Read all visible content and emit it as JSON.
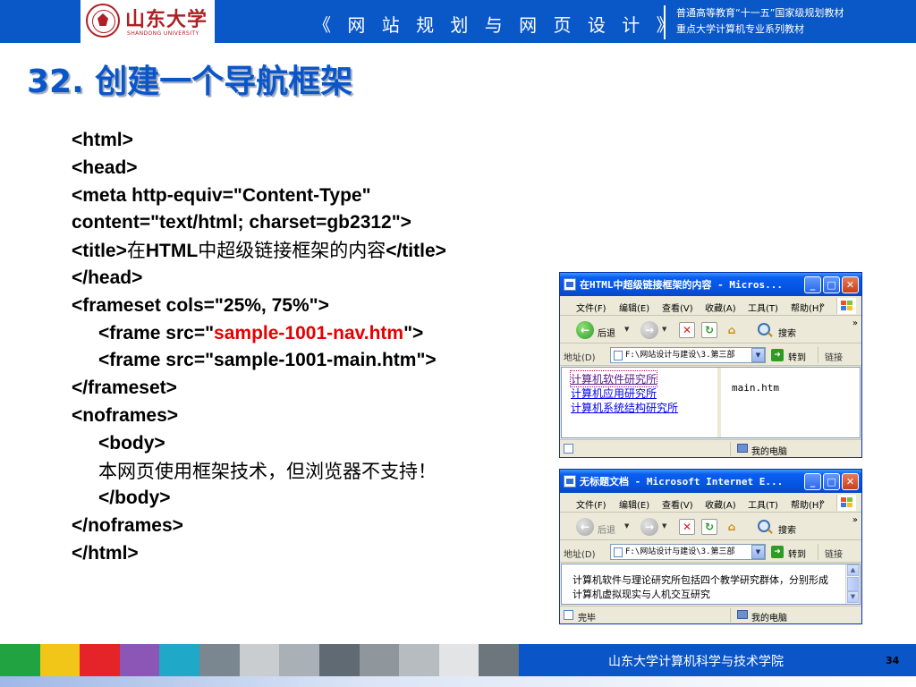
{
  "header": {
    "logo_name": "山东大学",
    "logo_en": "SHANDONG UNIVERSITY",
    "course_title": "《 网 站 规 划 与 网 页 设 计 》",
    "series_line1": "普通高等教育“十一五”国家级规划教材",
    "series_line2": "重点大学计算机专业系列教材",
    "colors": {
      "header_bg": "#0a57c8",
      "logo_red": "#b01f24"
    }
  },
  "slide": {
    "title": "32. 创建一个导航框架",
    "code_lines": [
      {
        "text": "<html>",
        "indent": 0
      },
      {
        "text": "<head>",
        "indent": 0
      },
      {
        "text": "<meta http-equiv=\"Content-Type\"",
        "indent": 0
      },
      {
        "text": "content=\"text/html; charset=gb2312\">",
        "indent": 0
      },
      {
        "pre": "<title>",
        "cjk1": "在",
        "mid": "HTML",
        "cjk2": "中超级链接框架的内容",
        "post": "</title>",
        "indent": 0
      },
      {
        "text": "</head>",
        "indent": 0
      },
      {
        "text": "<frameset cols=\"25%, 75%\">",
        "indent": 0
      },
      {
        "pre": "<frame src=\"",
        "highlight": "sample-1001-nav.htm",
        "post": "\">",
        "indent": 1
      },
      {
        "text": "<frame src=\"sample-1001-main.htm\">",
        "indent": 1
      },
      {
        "text": "</frameset>",
        "indent": 0
      },
      {
        "text": "<noframes>",
        "indent": 0
      },
      {
        "text": "<body>",
        "indent": 1
      },
      {
        "text": "本网页使用框架技术，但浏览器不支持！",
        "indent": 1
      },
      {
        "text": "</body>",
        "indent": 1
      },
      {
        "text": "</noframes>",
        "indent": 0
      },
      {
        "text": "</html>",
        "indent": 0
      }
    ],
    "colors": {
      "title": "#0a56c8",
      "highlight": "#e60000"
    }
  },
  "browser1": {
    "title": "在HTML中超级链接框架的内容 - Micros...",
    "menu": [
      "文件(F)",
      "编辑(E)",
      "查看(V)",
      "收藏(A)",
      "工具(T)",
      "帮助(H)"
    ],
    "back_label": "后退",
    "search_label": "搜索",
    "address_label": "地址(D)",
    "address_value": "F:\\网站设计与建设\\3.第三部",
    "go_label": "转到",
    "links_label": "链接",
    "nav_links": [
      "计算机软件研究所",
      "计算机应用研究所",
      "计算机系统结构研究所"
    ],
    "main_frame_text": "main.htm",
    "status_text": "",
    "zone_text": "我的电脑"
  },
  "browser2": {
    "title": "无标题文档 - Microsoft Internet E...",
    "menu": [
      "文件(F)",
      "编辑(E)",
      "查看(V)",
      "收藏(A)",
      "工具(T)",
      "帮助(H)"
    ],
    "back_label": "后退",
    "search_label": "搜索",
    "address_label": "地址(D)",
    "address_value": "F:\\网站设计与建设\\3.第三部",
    "go_label": "转到",
    "links_label": "链接",
    "content_text": "计算机软件与理论研究所包括四个教学研究群体，分别形成计算机虚拟现实与人机交互研究",
    "status_text": "完毕",
    "zone_text": "我的电脑"
  },
  "footer": {
    "school": "山东大学计算机科学与技术学院",
    "page_number": "34",
    "strip_colors": [
      "#21a341",
      "#f2c618",
      "#e5242a",
      "#8c56b6",
      "#1fa8c8",
      "#7a8791",
      "#c9cdd0",
      "#aab1b6",
      "#5f6a72",
      "#8f969c",
      "#b7bcc0",
      "#e2e4e6",
      "#6d767d"
    ]
  }
}
